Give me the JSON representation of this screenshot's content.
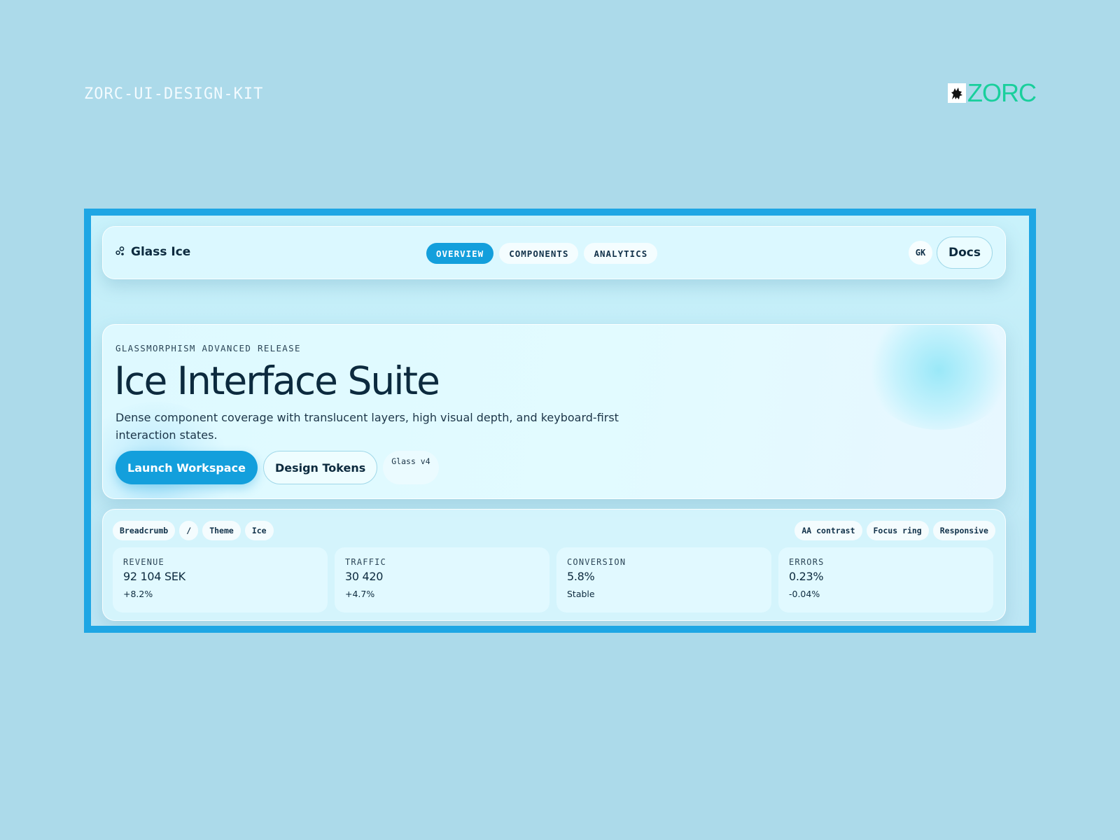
{
  "page": {
    "kit_title": "ZORC-UI-DESIGN-KIT",
    "brand_text": "ZORC"
  },
  "nav": {
    "brand": "Glass Ice",
    "tabs": [
      {
        "label": "OVERVIEW",
        "active": true
      },
      {
        "label": "COMPONENTS",
        "active": false
      },
      {
        "label": "ANALYTICS",
        "active": false
      }
    ],
    "avatar_initials": "GK",
    "docs_label": "Docs"
  },
  "hero": {
    "eyebrow": "GLASSMORPHISM ADVANCED RELEASE",
    "title": "Ice Interface Suite",
    "description": "Dense component coverage with translucent layers, high visual depth, and keyboard-first interaction states.",
    "primary_action": "Launch Workspace",
    "secondary_action": "Design Tokens",
    "version_chip": "Glass v4"
  },
  "breadcrumb": [
    "Breadcrumb",
    "/",
    "Theme",
    "Ice"
  ],
  "feature_chips": [
    "AA contrast",
    "Focus ring",
    "Responsive"
  ],
  "stats": [
    {
      "label": "REVENUE",
      "value": "92 104 SEK",
      "delta": "+8.2%"
    },
    {
      "label": "TRAFFIC",
      "value": "30 420",
      "delta": "+4.7%"
    },
    {
      "label": "CONVERSION",
      "value": "5.8%",
      "delta": "Stable"
    },
    {
      "label": "ERRORS",
      "value": "0.23%",
      "delta": "-0.04%"
    }
  ],
  "colors": {
    "accent": "#139fdc",
    "frame_border": "#1ea6e4",
    "brand_green": "#19cf9c",
    "background": "#acdaea"
  }
}
